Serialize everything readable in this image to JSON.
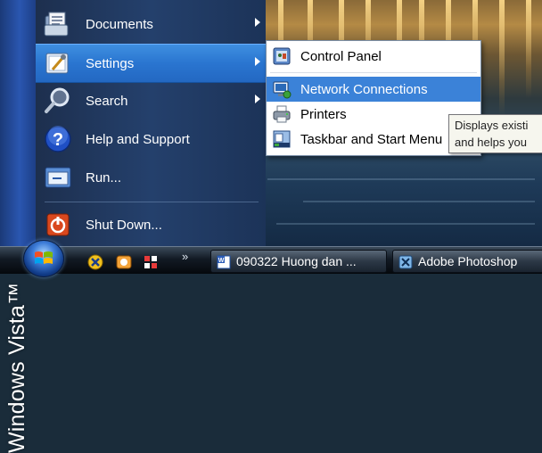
{
  "brand": {
    "text": "Windows Vista™"
  },
  "start_menu": {
    "items": [
      {
        "label": "Documents",
        "icon": "documents-icon",
        "has_submenu": true
      },
      {
        "label": "Settings",
        "icon": "settings-icon",
        "has_submenu": true
      },
      {
        "label": "Search",
        "icon": "search-icon",
        "has_submenu": true
      },
      {
        "label": "Help and Support",
        "icon": "help-icon",
        "has_submenu": false
      },
      {
        "label": "Run...",
        "icon": "run-icon",
        "has_submenu": false
      },
      {
        "label": "Shut Down...",
        "icon": "shutdown-icon",
        "has_submenu": false
      }
    ],
    "highlighted_item": "Settings"
  },
  "settings_submenu": {
    "items": [
      {
        "label": "Control Panel",
        "icon": "control-panel-icon"
      },
      {
        "label": "Network Connections",
        "icon": "network-connections-icon"
      },
      {
        "label": "Printers",
        "icon": "printers-icon"
      },
      {
        "label": "Taskbar and Start Menu",
        "icon": "taskbar-start-menu-icon"
      }
    ],
    "highlighted_item": "Network Connections"
  },
  "tooltip": {
    "line1": "Displays existi",
    "line2": "and helps you"
  },
  "taskbar": {
    "overflow_label": "»",
    "quick_launch": [
      "close-x-icon",
      "messenger-icon",
      "network-tray-icon"
    ],
    "buttons": [
      {
        "label": "090322 Huong dan ...",
        "icon": "word-document-icon"
      },
      {
        "label": "Adobe Photoshop",
        "icon": "photoshop-icon"
      }
    ]
  },
  "colors": {
    "menu_highlight": "#2a75d0",
    "submenu_highlight": "#3b82d8",
    "brand_strip": "#2a56b0"
  }
}
